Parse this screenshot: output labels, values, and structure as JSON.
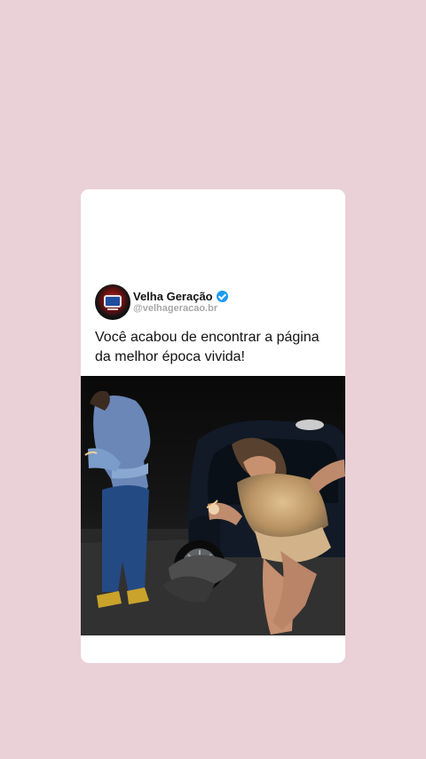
{
  "post": {
    "display_name": "Velha Geração",
    "handle": "@velhageracao.br",
    "text": "Você acabou de encontrar a página da melhor época vivida!",
    "verified": true,
    "media": {
      "type": "video-frame"
    }
  },
  "colors": {
    "page_background": "#e9d1d7",
    "card_background": "#ffffff",
    "verified_badge": "#1d9bf0"
  }
}
